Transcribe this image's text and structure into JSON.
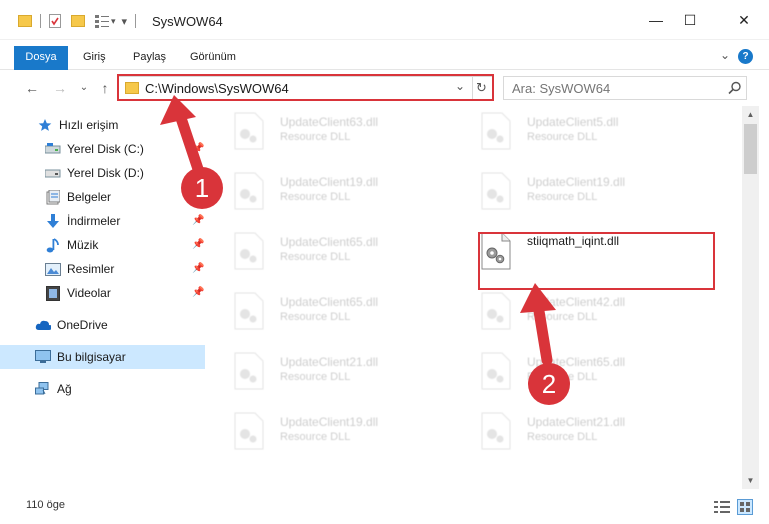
{
  "window": {
    "title": "SysWOW64",
    "minimize": "—",
    "maximize": "☐",
    "close": "✕"
  },
  "ribbon": {
    "tabs": [
      "Dosya",
      "Giriş",
      "Paylaş",
      "Görünüm"
    ],
    "collapse": "⌄",
    "help": "?"
  },
  "nav": {
    "back": "←",
    "forward": "→",
    "recent": "⌄",
    "up": "↑"
  },
  "address": {
    "path": "C:\\Windows\\SysWOW64",
    "dropdown": "⌄",
    "refresh": "↻"
  },
  "search": {
    "placeholder": "Ara: SysWOW64",
    "icon": "search-icon"
  },
  "sidebar": {
    "items": [
      {
        "label": "Hızlı erişim",
        "icon": "star-icon",
        "pinned": false
      },
      {
        "label": "Yerel Disk (C:)",
        "icon": "drive-icon",
        "pinned": true
      },
      {
        "label": "Yerel Disk (D:)",
        "icon": "drive-icon",
        "pinned": true
      },
      {
        "label": "Belgeler",
        "icon": "documents-icon",
        "pinned": true
      },
      {
        "label": "İndirmeler",
        "icon": "download-icon",
        "pinned": true
      },
      {
        "label": "Müzik",
        "icon": "music-icon",
        "pinned": true
      },
      {
        "label": "Resimler",
        "icon": "pictures-icon",
        "pinned": true
      },
      {
        "label": "Videolar",
        "icon": "videos-icon",
        "pinned": true
      },
      {
        "label": "OneDrive",
        "icon": "cloud-icon",
        "pinned": false
      },
      {
        "label": "Bu bilgisayar",
        "icon": "computer-icon",
        "pinned": false,
        "selected": true
      },
      {
        "label": "Ağ",
        "icon": "network-icon",
        "pinned": false
      }
    ]
  },
  "files": [
    {
      "name": "UpdateClient63.dll",
      "type": "Resource DLL",
      "faded": true
    },
    {
      "name": "UpdateClient5.dll",
      "type": "Resource DLL",
      "faded": true
    },
    {
      "name": "UpdateClient19.dll",
      "type": "Resource DLL",
      "faded": true
    },
    {
      "name": "UpdateClient19.dll",
      "type": "Resource DLL",
      "faded": true
    },
    {
      "name": "UpdateClient65.dll",
      "type": "Resource DLL",
      "faded": true
    },
    {
      "name": "stiiqmath_iqint.dll",
      "type": "",
      "faded": false
    },
    {
      "name": "UpdateClient65.dll",
      "type": "Resource DLL",
      "faded": true
    },
    {
      "name": "UpdateClient42.dll",
      "type": "Resource DLL",
      "faded": true
    },
    {
      "name": "UpdateClient21.dll",
      "type": "Resource DLL",
      "faded": true
    },
    {
      "name": "UpdateClient65.dll",
      "type": "Resource DLL",
      "faded": true
    },
    {
      "name": "UpdateClient19.dll",
      "type": "Resource DLL",
      "faded": true
    },
    {
      "name": "UpdateClient21.dll",
      "type": "Resource DLL",
      "faded": true
    }
  ],
  "status": {
    "count": "110 öge"
  },
  "annotations": {
    "step1": "1",
    "step2": "2",
    "color": "#d9343a"
  },
  "colors": {
    "accent": "#1979ca",
    "selection": "#cce8ff",
    "highlight": "#d9343a"
  }
}
